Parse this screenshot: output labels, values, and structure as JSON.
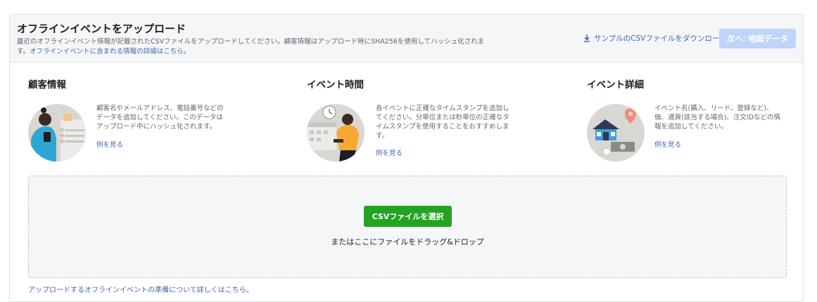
{
  "header": {
    "title": "オフラインイベントをアップロード",
    "description": "最近のオフラインイベント情報が記載されたCSVファイルをアップロードしてください。顧客情報はアップロード時にSHA256を使用してハッシュ化されます。",
    "details_link": "オフラインイベントに含まれる情報の詳細はこちら。",
    "download_link": "サンプルのCSVファイルをダウンロード",
    "next_button": "次へ: 地図データ"
  },
  "columns": [
    {
      "title": "顧客情報",
      "text": "顧客名やメールアドレス、電話番号などのデータを追加してください。このデータはアップロード中にハッシュ化されます。",
      "link": "例を見る",
      "icon": "customer-info-illustration"
    },
    {
      "title": "イベント時間",
      "text": "各イベントに正確なタイムスタンプを追加してください。分単位または秒単位の正確なタイムスタンプを使用することをおすすめします。",
      "link": "例を見る",
      "icon": "event-time-illustration"
    },
    {
      "title": "イベント詳細",
      "text": "イベント名(購入、リード、登録など)、価、通貨(該当する場合)、注文IDなどの情報を追加してください。",
      "link": "例を見る",
      "icon": "event-details-illustration"
    }
  ],
  "dropzone": {
    "button": "CSVファイルを選択",
    "text": "またはここにファイルをドラッグ&ドロップ"
  },
  "footer_link": "アップロードするオフラインイベントの準備について詳しくはこちら。",
  "colors": {
    "link": "#4267b2",
    "primary_disabled": "#bed4f8",
    "success": "#23a322",
    "header_bg": "#f5f6f7"
  }
}
